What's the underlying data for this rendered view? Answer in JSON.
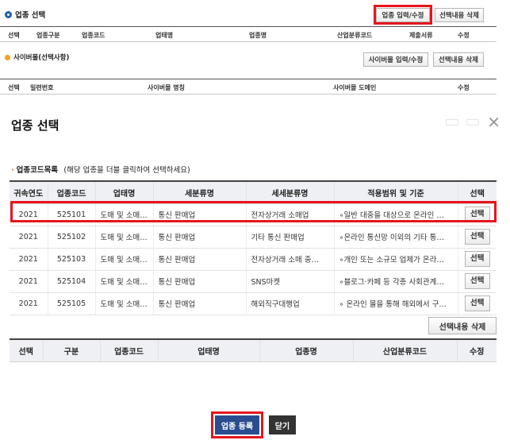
{
  "background": {
    "section1": {
      "title": "업종 선택",
      "btn_input": "업종 입력/수정",
      "btn_delete": "선택내용 삭제",
      "columns": [
        "선택",
        "업종구분",
        "업종코드",
        "업태명",
        "업종명",
        "산업분류코드",
        "제출서류",
        "수정"
      ]
    },
    "section2": {
      "title": "사이버몰(선택사항)",
      "btn_input": "사이버몰 입력/수정",
      "btn_delete": "선택내용 삭제",
      "columns": [
        "선택",
        "일련번호",
        "사이버몰 명칭",
        "사이버몰 도메인",
        "수정"
      ]
    }
  },
  "modal": {
    "title": "업종 선택",
    "close_glyph": "✕",
    "list_title": "업종코드목록",
    "list_hint": "(해당 업종을 더블 클릭하여 선택하세요)",
    "columns": [
      "귀속연도",
      "업종코드",
      "업태명",
      "세분류명",
      "세세분류명",
      "적용범위 및 기준",
      "선택"
    ],
    "rows": [
      {
        "year": "2021",
        "code": "525101",
        "biz": "도매 및 소매…",
        "sub": "통신 판매업",
        "subsub": "전자상거래 소매업",
        "scope": "∘일반 대중을 대상으로 온라인 …",
        "btn": "선택"
      },
      {
        "year": "2021",
        "code": "525102",
        "biz": "도매 및 소매…",
        "sub": "통신 판매업",
        "subsub": "기타 통신 판매업",
        "scope": "∘온라인 통신망 이외의 기타 통…",
        "btn": "선택"
      },
      {
        "year": "2021",
        "code": "525103",
        "biz": "도매 및 소매…",
        "sub": "통신 판매업",
        "subsub": "전자상거래 소매 중…",
        "scope": "∘개인 또는 소규모 업체가 온라…",
        "btn": "선택"
      },
      {
        "year": "2021",
        "code": "525104",
        "biz": "도매 및 소매…",
        "sub": "통신 판매업",
        "subsub": "SNS마켓",
        "scope": "∘블로그·카페 등 각종 사회관계…",
        "btn": "선택"
      },
      {
        "year": "2021",
        "code": "525105",
        "biz": "도매 및 소매…",
        "sub": "통신 판매업",
        "subsub": "해외직구대행업",
        "scope": "∘ 온라인 몰을 통해 해외에서 구…",
        "btn": "선택"
      }
    ],
    "delete_btn": "선택내용 삭제",
    "selected_columns": [
      "선택",
      "구분",
      "업종코드",
      "업태명",
      "업종명",
      "산업분류코드",
      "수정"
    ],
    "register_btn": "업종 등록",
    "close_btn": "닫기"
  },
  "colors": {
    "highlight": "#e8141c",
    "primary_button": "#2a4d8f",
    "dark_button": "#333333",
    "header_bg": "#eef0f4"
  }
}
